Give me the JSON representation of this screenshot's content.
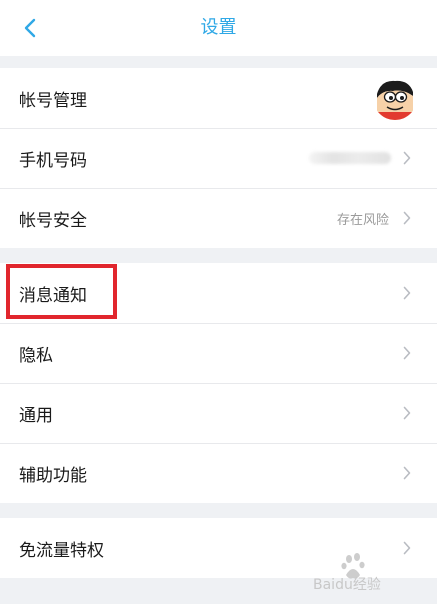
{
  "header": {
    "title": "设置"
  },
  "groups": [
    {
      "items": [
        {
          "label": "帐号管理"
        },
        {
          "label": "手机号码"
        },
        {
          "label": "帐号安全",
          "value": "存在风险"
        }
      ]
    },
    {
      "items": [
        {
          "label": "消息通知"
        },
        {
          "label": "隐私"
        },
        {
          "label": "通用"
        },
        {
          "label": "辅助功能"
        }
      ]
    },
    {
      "items": [
        {
          "label": "免流量特权"
        }
      ]
    }
  ],
  "icons": {
    "back": "chevron-left-icon",
    "row_arrow": "chevron-right-icon"
  },
  "colors": {
    "accent": "#2fa8e6",
    "highlight": "#e1262d",
    "background": "#eff1f4"
  },
  "watermark": {
    "text": "Baidu经验"
  }
}
